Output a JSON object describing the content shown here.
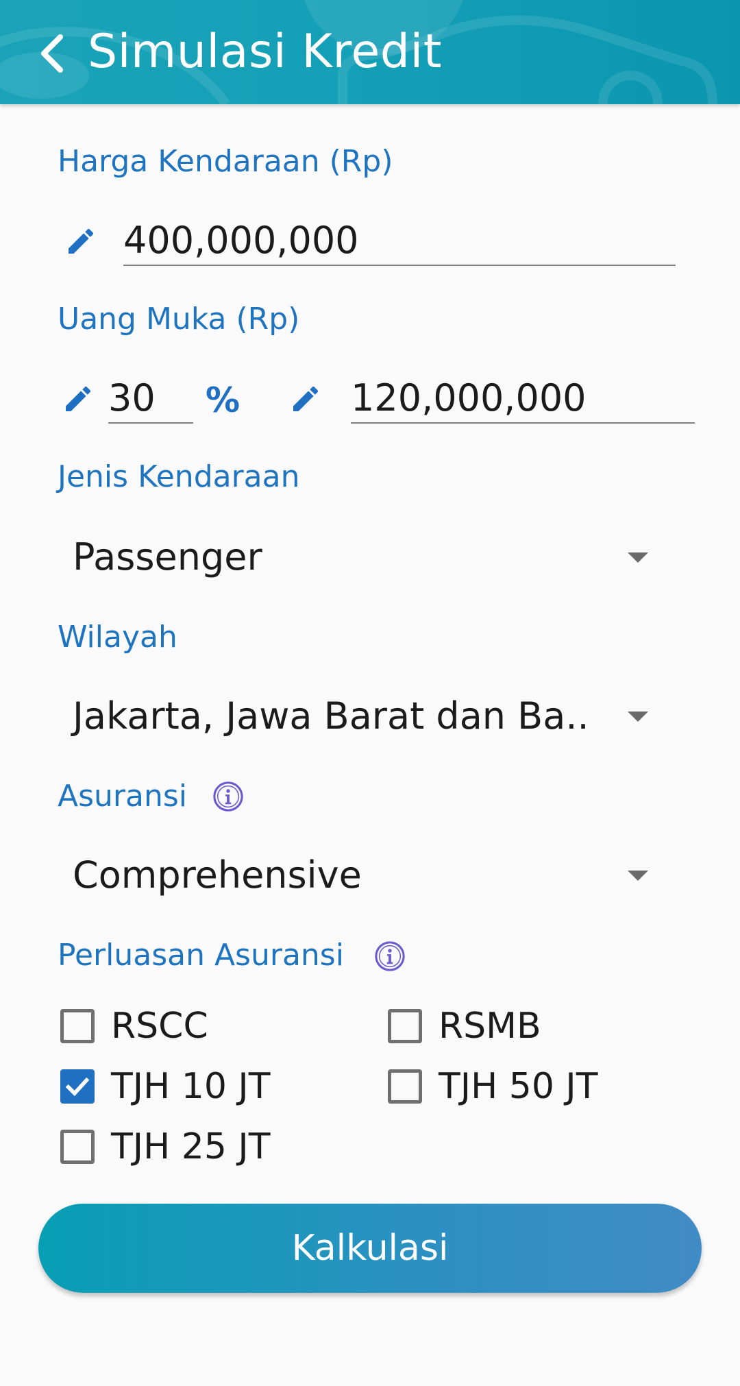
{
  "app_bar": {
    "title": "Simulasi Kredit",
    "background_color": "#14a0b7",
    "icons": {
      "back": "back-arrow-icon"
    }
  },
  "form": {
    "harga_kendaraan": {
      "label": "Harga Kendaraan (Rp)",
      "value": "400,000,000",
      "icon": "pencil-icon"
    },
    "uang_muka": {
      "label": "Uang Muka (Rp)",
      "percent_value": "30",
      "percent_symbol": "%",
      "amount_value": "120,000,000",
      "icon": "pencil-icon"
    },
    "jenis_kendaraan": {
      "label": "Jenis Kendaraan",
      "selected": "Passenger"
    },
    "wilayah": {
      "label": "Wilayah",
      "selected": "Jakarta, Jawa Barat dan Ba.."
    },
    "asuransi": {
      "label": "Asuransi",
      "selected": "Comprehensive",
      "info_icon": "info-icon"
    },
    "perluasan_asuransi": {
      "label": "Perluasan Asuransi",
      "info_icon": "info-icon",
      "options": [
        {
          "label": "RSCC",
          "checked": false
        },
        {
          "label": "RSMB",
          "checked": false
        },
        {
          "label": "TJH 10 JT",
          "checked": true
        },
        {
          "label": "TJH 50 JT",
          "checked": false
        },
        {
          "label": "TJH 25 JT",
          "checked": false
        }
      ]
    }
  },
  "actions": {
    "calculate_label": "Kalkulasi"
  },
  "colors": {
    "label_blue": "#1f74c0",
    "checkbox_checked": "#1f6fc2",
    "info_icon": "#6a5ad0",
    "button_gradient_start": "#079eb4",
    "button_gradient_end": "#418bc5"
  }
}
